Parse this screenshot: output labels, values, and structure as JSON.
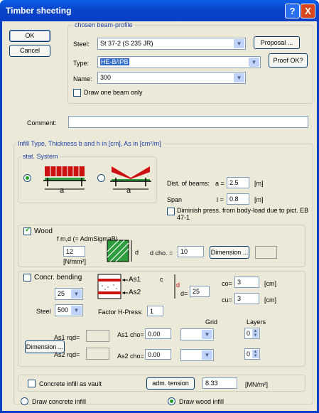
{
  "window": {
    "title": "Timber sheeting",
    "help_glyph": "?",
    "close_glyph": "X"
  },
  "buttons": {
    "ok": "OK",
    "cancel": "Cancel",
    "proposal": "Proposal ...",
    "proof": "Proof OK?",
    "dimension_wood": "Dimension ...",
    "dimension_concr": "Dimension ...",
    "adm_tension": "adm. tension"
  },
  "beam_profile": {
    "legend": "chosen beam-profile",
    "steel_label": "Steel:",
    "steel_value": "St 37-2 (S 235 JR)",
    "type_label": "Type:",
    "type_value": "HE-B/IPB",
    "name_label": "Name:",
    "name_value": "300",
    "draw_one_label": "Draw one beam only"
  },
  "comment": {
    "label": "Comment:",
    "value": ""
  },
  "infill": {
    "legend": "Infill  Type, Thickness b and h in [cm], As in [cm²/m]",
    "stat_system": "stat. System",
    "dist_label": "Dist. of beams:",
    "dist_var": "a =",
    "dist_value": "2.5",
    "dist_unit": "[m]",
    "span_label": "Span",
    "span_var": "l =",
    "span_value": "0.8",
    "span_unit": "[m]",
    "diminish_label": "Diminish press. from body-load due to pict. EB 47-1",
    "a_glyph": "a"
  },
  "wood": {
    "label": "Wood",
    "fmd_label": "f m,d  (= AdmSigmaB)",
    "fmd_value": "12",
    "fmd_unit": "[N/mm²]",
    "d_label": "d cho. =",
    "d_value": "10",
    "d_glyph": "d"
  },
  "concrete": {
    "bending_label": "Concr. bending",
    "grade_value": "25",
    "steel_label": "Steel",
    "steel_value": "500",
    "d_label": "d=",
    "d_value": "25",
    "co_label": "co=",
    "co_value": "3",
    "co_unit": "[cm]",
    "cu_label": "cu=",
    "cu_value": "3",
    "cu_unit": "[cm]",
    "factor_label": "Factor H-Press:",
    "factor_value": "1",
    "grid_label": "Grid",
    "layers_label": "Layers",
    "as1_rqd": "As1 rqd=",
    "as1_cho": "As1 cho=",
    "as1_value": "0.00",
    "as1_layers": "0",
    "as2_rqd": "As2 rqd=",
    "as2_cho": "As2 cho=",
    "as2_value": "0.00",
    "as2_layers": "0",
    "as1_glyph": "As1",
    "as2_glyph": "As2",
    "c_glyph": "c",
    "d_glyph": "d"
  },
  "vault": {
    "label": "Concrete infill as vault",
    "value": "8.33",
    "unit": "[MN/m²]"
  },
  "draw": {
    "concrete_label": "Draw concrete infill",
    "wood_label": "Draw wood infill"
  },
  "colors": {
    "titlebar": "#0a3fc7",
    "face": "#ece9d8",
    "selection": "#316ac5",
    "accent_red": "#cc1111",
    "wood_green": "#2c9c3c"
  }
}
